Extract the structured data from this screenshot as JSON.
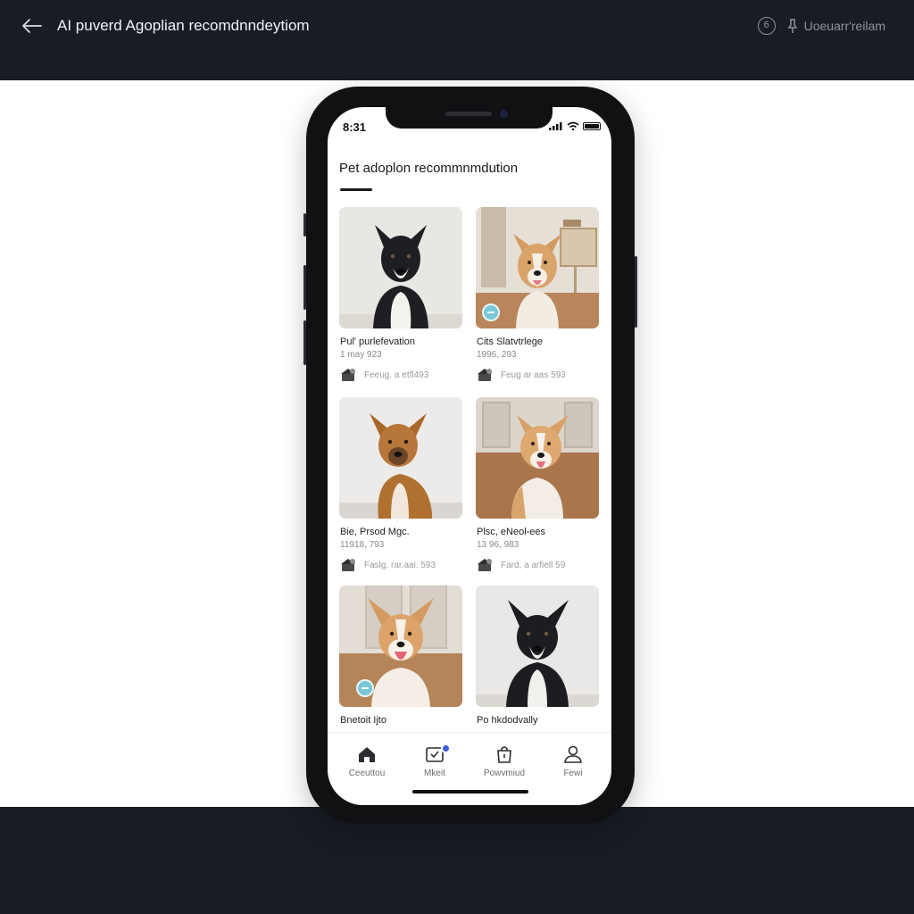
{
  "header": {
    "back_icon": "arrow-left-icon",
    "title": "AI puverd Agoplian recomdnndeytiom",
    "info_icon_glyph": "6",
    "user_label": "Uoeuarr'reilam"
  },
  "phone": {
    "status_time": "8:31",
    "screen_title": "Pet adoplon recommnmdution",
    "pets": [
      {
        "name": "Pul' purlefevation",
        "meta": "1 may 923",
        "shelter": "Feeug. a etfl493"
      },
      {
        "name": "Cits Slatvtrlege",
        "meta": "1996, 293",
        "shelter": "Feug ar aas 593"
      },
      {
        "name": "Bie, Prsod Mgc.",
        "meta": "11918, 793",
        "shelter": "Faslg. rar.aai. 593"
      },
      {
        "name": "Plsc, eNeol-ees",
        "meta": "13 96, 983",
        "shelter": "Fard, a arfiell 59"
      },
      {
        "name": "Bnetoit Ijto",
        "meta": "",
        "shelter": ""
      },
      {
        "name": "Po hkdodvally",
        "meta": "",
        "shelter": ""
      }
    ],
    "tabs": [
      {
        "label": "Ceeuttou",
        "icon": "home-icon"
      },
      {
        "label": "Mkeit",
        "icon": "mail-check-icon"
      },
      {
        "label": "Powvmiud",
        "icon": "bag-icon"
      },
      {
        "label": "Fewi",
        "icon": "person-icon"
      }
    ]
  },
  "colors": {
    "frame_bg": "#181c25",
    "badge": "#77c7d6",
    "notification_dot": "#3f5bd8"
  }
}
